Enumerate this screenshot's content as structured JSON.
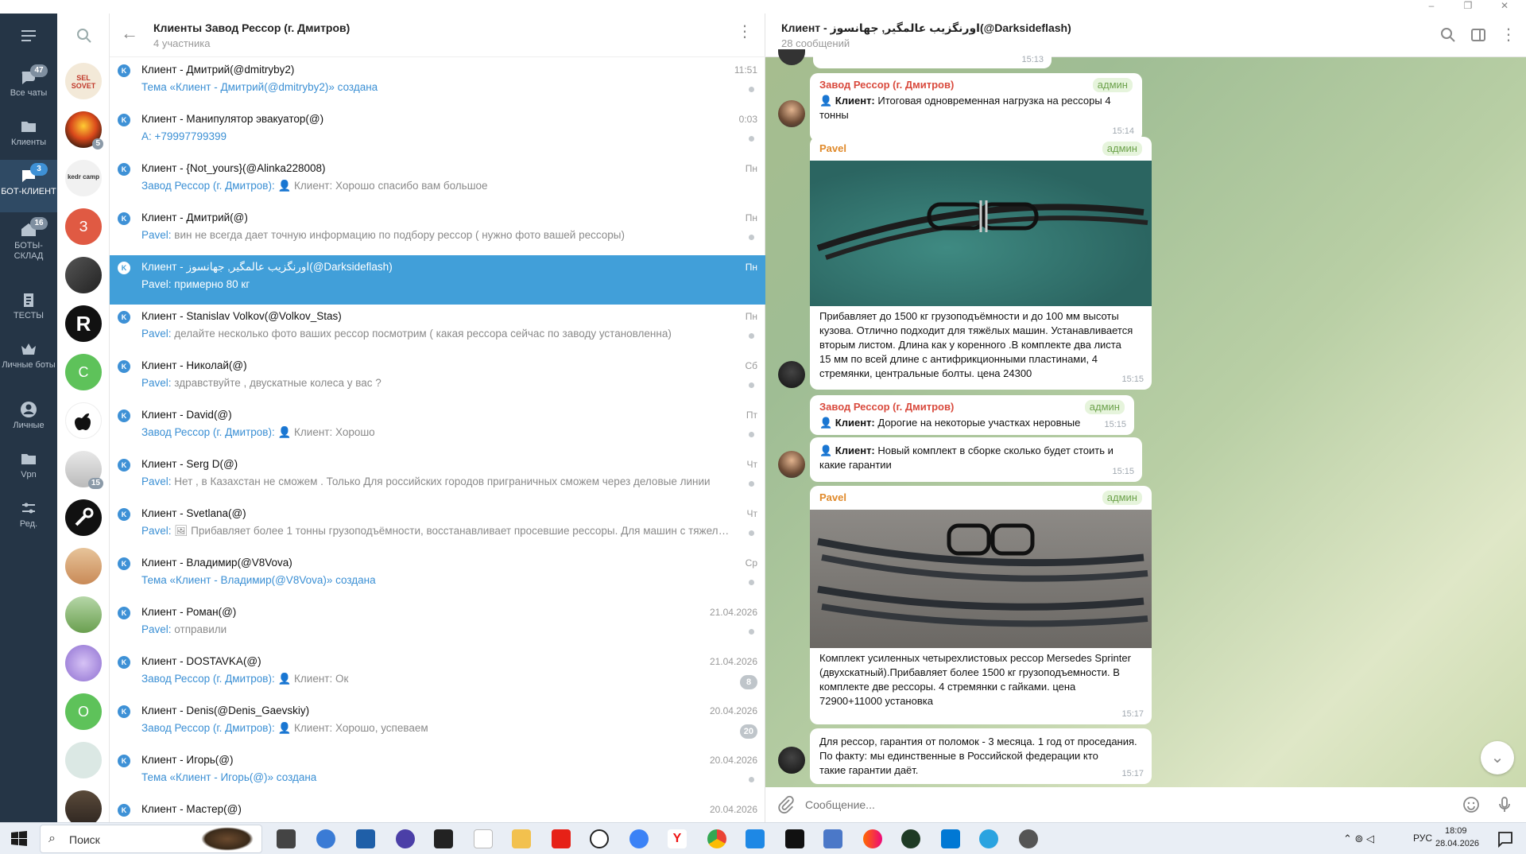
{
  "window": {
    "minimize": "–",
    "restore": "❐",
    "close": "✕"
  },
  "rail": [
    {
      "label": "Все чаты",
      "badge": "47",
      "icon": "chats-icon"
    },
    {
      "label": "Клиенты",
      "badge": "",
      "icon": "folder-icon"
    },
    {
      "label": "БОТ-КЛИЕНТ",
      "badge": "3",
      "icon": "chat-icon"
    },
    {
      "label": "БОТЫ-СКЛАД",
      "badge": "16",
      "icon": "home-icon"
    },
    {
      "label": "ТЕСТЫ",
      "badge": "",
      "icon": "clipboard-icon"
    },
    {
      "label": "Личные боты",
      "badge": "",
      "icon": "crown-icon"
    },
    {
      "label": "Личные",
      "badge": "",
      "icon": "person-icon"
    },
    {
      "label": "Vpn",
      "badge": "",
      "icon": "folder-icon"
    },
    {
      "label": "Ред.",
      "badge": "",
      "icon": "settings-sliders-icon"
    }
  ],
  "forum_avatars": [
    {
      "label": "SEL SOVET",
      "badge": ""
    },
    {
      "label": "",
      "badge": "5"
    },
    {
      "label": "kedr camp",
      "badge": ""
    },
    {
      "label": "З",
      "badge": ""
    },
    {
      "label": "",
      "badge": ""
    },
    {
      "label": "R",
      "badge": ""
    },
    {
      "label": "С",
      "badge": ""
    },
    {
      "label": "",
      "badge": ""
    },
    {
      "label": "",
      "badge": "15"
    },
    {
      "label": "",
      "badge": ""
    },
    {
      "label": "",
      "badge": ""
    },
    {
      "label": "",
      "badge": ""
    },
    {
      "label": "",
      "badge": ""
    },
    {
      "label": "О",
      "badge": ""
    },
    {
      "label": "",
      "badge": ""
    },
    {
      "label": "",
      "badge": ""
    }
  ],
  "list_header": {
    "title": "Клиенты Завод Рессор (г. Дмитров)",
    "subtitle": "4 участника"
  },
  "topics": [
    {
      "name": "Клиент - Дмитрий(@dmitryby2)",
      "who": "",
      "text": "Тема «Клиент - Дмитрий(@dmitryby2)» создана",
      "time": "11:51",
      "badge": "",
      "topic": true
    },
    {
      "name": "Клиент - Манипулятор эвакуатор(@)",
      "who": "",
      "text": "А: +79997799399",
      "time": "0:03",
      "badge": "",
      "topic": true
    },
    {
      "name": "Клиент - {Not_yours}(@Alinka228008)",
      "who": "Завод Рессор (г. Дмитров):",
      "text": "👤 Клиент: Хорошо спасибо вам большое",
      "time": "Пн",
      "badge": "",
      "topic": false
    },
    {
      "name": "Клиент - Дмитрий(@)",
      "who": "Pavel:",
      "text": "вин не всегда дает точную информацию по подбору рессор ( нужно фото вашей рессоры)",
      "time": "Пн",
      "badge": "",
      "topic": false
    },
    {
      "name": "Клиент - اورنگزیب عالمگیر, جهانسوز(@Darksideflash)",
      "who": "Pavel:",
      "text": "примерно 80 кг",
      "time": "Пн",
      "badge": "",
      "topic": false
    },
    {
      "name": "Клиент - Stanislav Volkov(@Volkov_Stas)",
      "who": "Pavel:",
      "text": "делайте несколько фото ваших рессор посмотрим ( какая рессора сейчас по заводу установленна)",
      "time": "Пн",
      "badge": "",
      "topic": false
    },
    {
      "name": "Клиент - Николай(@)",
      "who": "Pavel:",
      "text": "здравствуйте , двускатные колеса у вас ?",
      "time": "Сб",
      "badge": "",
      "topic": false
    },
    {
      "name": "Клиент - David(@)",
      "who": "Завод Рессор (г. Дмитров):",
      "text": "👤 Клиент: Хорошо",
      "time": "Пт",
      "badge": "",
      "topic": false
    },
    {
      "name": "Клиент - Serg D(@)",
      "who": "Pavel:",
      "text": "Нет , в Казахстан не сможем . Только Для российских городов приграничных сможем через деловые линии",
      "time": "Чт",
      "badge": "",
      "topic": false
    },
    {
      "name": "Клиент - Svetlana(@)",
      "who": "Pavel:",
      "text": "🖼 Прибавляет более 1 тонны  грузоподъёмности, восстанавливает просевшие рессоры. Для машин с тяжелона...",
      "time": "Чт",
      "badge": "",
      "topic": false
    },
    {
      "name": "Клиент - Владимир(@V8Vova)",
      "who": "",
      "text": "Тема «Клиент - Владимир(@V8Vova)» создана",
      "time": "Ср",
      "badge": "",
      "topic": true
    },
    {
      "name": "Клиент - Роман(@)",
      "who": "Pavel:",
      "text": "отправили",
      "time": "21.04.2026",
      "badge": "",
      "topic": false
    },
    {
      "name": "Клиент - DOSTAVKA(@)",
      "who": "Завод Рессор (г. Дмитров):",
      "text": "👤 Клиент: Ок",
      "time": "21.04.2026",
      "badge": "8",
      "topic": false
    },
    {
      "name": "Клиент - Denis(@Denis_Gaevskiy)",
      "who": "Завод Рессор (г. Дмитров):",
      "text": "👤 Клиент: Хорошо, успеваем",
      "time": "20.04.2026",
      "badge": "20",
      "topic": false
    },
    {
      "name": "Клиент - Игорь(@)",
      "who": "",
      "text": "Тема «Клиент - Игорь(@)» создана",
      "time": "20.04.2026",
      "badge": "",
      "topic": true
    },
    {
      "name": "Клиент - Мастер(@)",
      "who": "",
      "text": "",
      "time": "20.04.2026",
      "badge": "",
      "topic": false
    }
  ],
  "chat_header": {
    "title": "Клиент - اورنگزیب عالمگیر, جهانسوز(@Darksideflash)",
    "subtitle": "28 сообщений"
  },
  "messages": {
    "m0_time": "15:13",
    "m1": {
      "author": "Завод Рессор (г. Дмитров)",
      "role": "админ",
      "prefix": "👤 Клиент:",
      "text_l1": " Итоговая одновременная нагрузка на рессоры 4",
      "text_l2": "тонны",
      "time": "15:14"
    },
    "m2": {
      "author": "Pavel",
      "role": "админ",
      "lines": [
        "Прибавляет до 1500 кг грузоподъёмности и до 100 мм высоты",
        "кузова. Отлично подходит для тяжёлых машин. Устанавливается",
        "вторым листом. Длина как у коренного .В комплекте два листа",
        "15 мм по всей длине с антифрикционными пластинами, 4",
        "стремянки, центральные болты. цена 24300"
      ],
      "time": "15:15"
    },
    "m3": {
      "author": "Завод Рессор (г. Дмитров)",
      "role": "админ",
      "prefix": "👤 Клиент:",
      "text": " Дорогие на некоторые участках неровные",
      "time": "15:15"
    },
    "m4": {
      "prefix": "👤 Клиент:",
      "text_l1": " Новый комплект в сборке сколько будет стоить и",
      "text_l2": "какие гарантии",
      "time": "15:15"
    },
    "m5": {
      "author": "Pavel",
      "role": "админ",
      "lines": [
        "Комплект усиленных четырехлистовых рессор Mersedes Sprinter",
        "(двухскатный).Прибавляет более 1500 кг грузоподъемности. В",
        "комплекте две рессоры. 4 стремянки с гайками. цена",
        "72900+11000 установка"
      ],
      "time": "15:17"
    },
    "m6": {
      "lines": [
        "Для рессор, гарантия от поломок - 3 месяца. 1 год от проседания.",
        "По факту: мы единственные в Российской федерации кто",
        "такие гарантии даёт."
      ],
      "time": "15:17"
    }
  },
  "input": {
    "placeholder": "Сообщение..."
  },
  "taskbar": {
    "search": "Поиск",
    "lang": "РУС",
    "time": "18:09",
    "date": "28.04.2026"
  },
  "colors": {
    "rail": "#253546",
    "accent": "#419fd9",
    "admin_role": "#6da24c",
    "red_author": "#d94a3d",
    "pavel_author": "#e08a2b"
  }
}
